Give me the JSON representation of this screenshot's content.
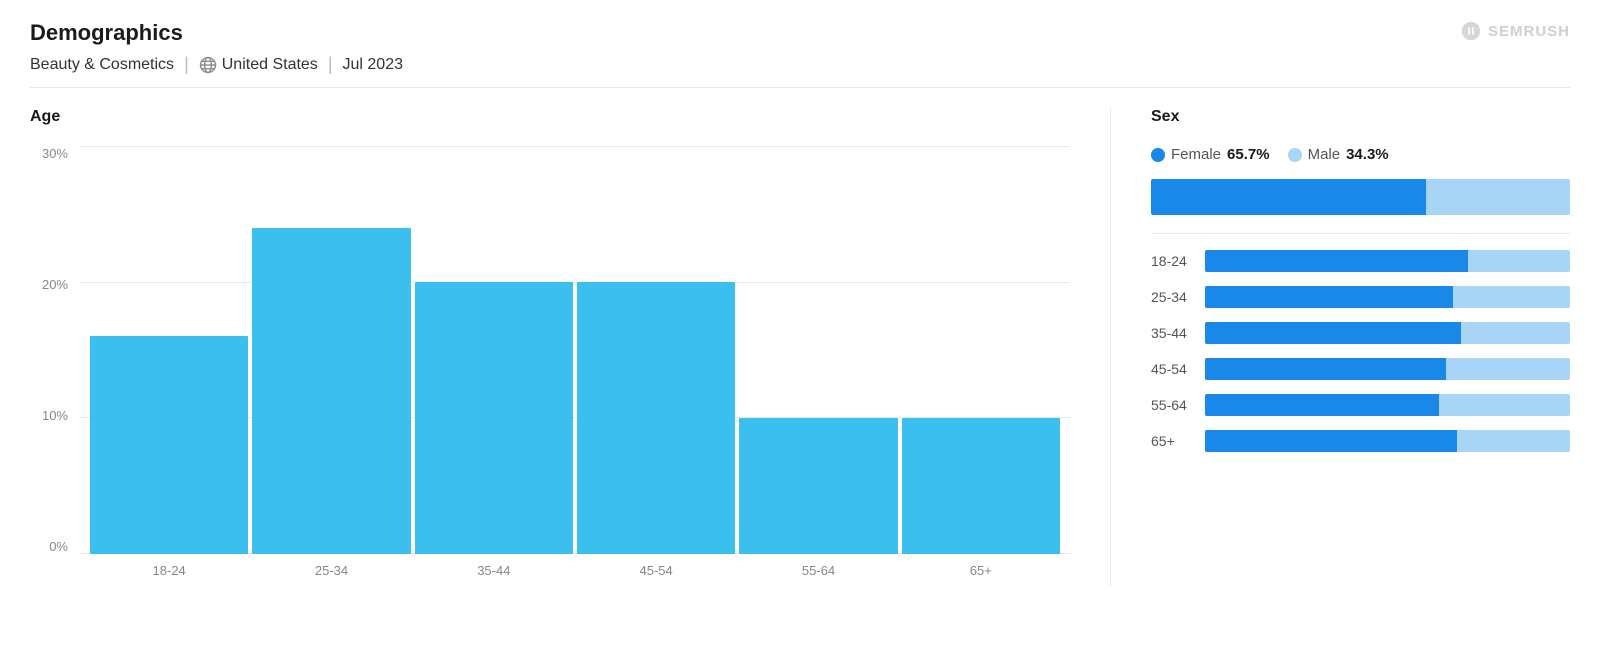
{
  "header": {
    "title": "Demographics",
    "category": "Beauty & Cosmetics",
    "country": "United States",
    "period": "Jul 2023",
    "logo": "SEMRUSH"
  },
  "age_chart": {
    "title": "Age",
    "y_labels": [
      "30%",
      "20%",
      "10%",
      "0%"
    ],
    "bars": [
      {
        "label": "18-24",
        "pct": 16
      },
      {
        "label": "25-34",
        "pct": 24
      },
      {
        "label": "35-44",
        "pct": 20
      },
      {
        "label": "45-54",
        "pct": 20
      },
      {
        "label": "55-64",
        "pct": 10
      },
      {
        "label": "65+",
        "pct": 10
      }
    ],
    "max_pct": 30
  },
  "sex_chart": {
    "title": "Sex",
    "female_label": "Female",
    "female_pct": "65.7%",
    "male_label": "Male",
    "male_pct": "34.3%",
    "female_ratio": 65.7,
    "male_ratio": 34.3,
    "age_sex_rows": [
      {
        "label": "18-24",
        "female": 72,
        "male": 28
      },
      {
        "label": "25-34",
        "female": 68,
        "male": 32
      },
      {
        "label": "35-44",
        "female": 70,
        "male": 30
      },
      {
        "label": "45-54",
        "female": 66,
        "male": 34
      },
      {
        "label": "55-64",
        "female": 64,
        "male": 36
      },
      {
        "label": "65+",
        "female": 69,
        "male": 31
      }
    ]
  }
}
